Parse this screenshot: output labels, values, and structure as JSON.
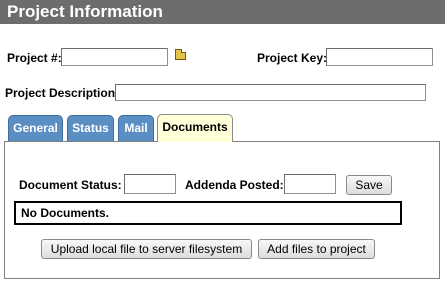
{
  "header": {
    "title": "Project Information"
  },
  "project": {
    "number_label": "Project #:",
    "number_value": "",
    "key_label": "Project Key:",
    "key_value": "",
    "description_label": "Project Description:",
    "description_value": ""
  },
  "tabs": [
    {
      "label": "General",
      "active": false
    },
    {
      "label": "Status",
      "active": false
    },
    {
      "label": "Mail",
      "active": false
    },
    {
      "label": "Documents",
      "active": true
    }
  ],
  "documents": {
    "status_label": "Document Status:",
    "status_value": "",
    "addenda_label": "Addenda Posted:",
    "addenda_value": "",
    "save_label": "Save",
    "empty_message": "No Documents.",
    "upload_label": "Upload local file to server filesystem",
    "add_files_label": "Add files to project"
  },
  "colors": {
    "title_bar": "#6d6d6d",
    "tab_inactive": "#5b8fc4",
    "tab_active": "#ffffd8"
  },
  "icons": {
    "browse": "folder-icon"
  }
}
